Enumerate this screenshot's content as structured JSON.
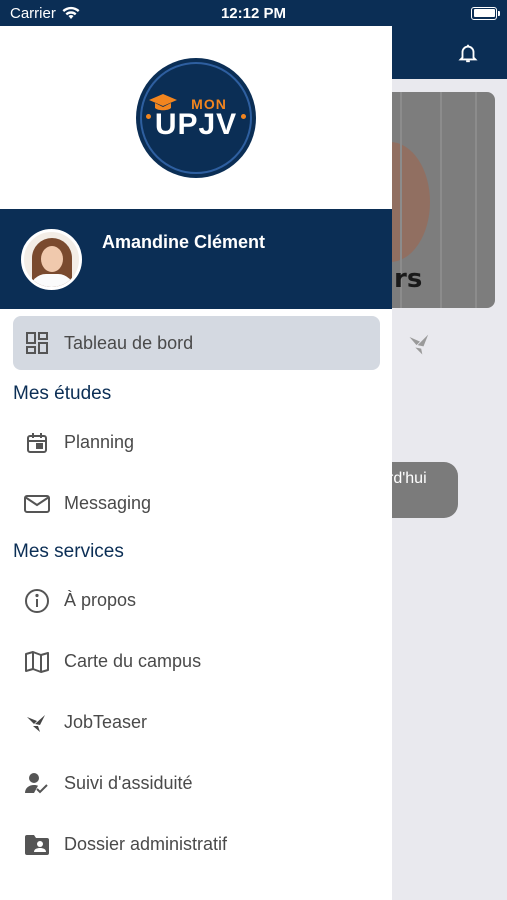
{
  "status_bar": {
    "carrier": "Carrier",
    "time": "12:12 PM",
    "battery_level": 1.0
  },
  "logo": {
    "line1": "MON",
    "line2": "UPJV"
  },
  "profile": {
    "name": "Amandine Clément"
  },
  "dashboard": {
    "label": "Tableau de bord",
    "icon": "dashboard-icon"
  },
  "sections": {
    "studies": {
      "title": "Mes études",
      "items": [
        {
          "label": "Planning",
          "icon": "calendar-icon"
        },
        {
          "label": "Messaging",
          "icon": "mail-icon"
        }
      ]
    },
    "services": {
      "title": "Mes services",
      "items": [
        {
          "label": "À propos",
          "icon": "info-icon"
        },
        {
          "label": "Carte du campus",
          "icon": "map-icon"
        },
        {
          "label": "JobTeaser",
          "icon": "jobteaser-icon"
        },
        {
          "label": "Suivi d'assiduité",
          "icon": "attendance-icon"
        },
        {
          "label": "Dossier administratif",
          "icon": "folder-icon"
        }
      ]
    }
  },
  "background": {
    "card_text": "rs",
    "pill_text": "rd'hui"
  },
  "colors": {
    "primary": "#0b2e55",
    "accent": "#f2851f",
    "active_bg": "#d4d9e1"
  }
}
